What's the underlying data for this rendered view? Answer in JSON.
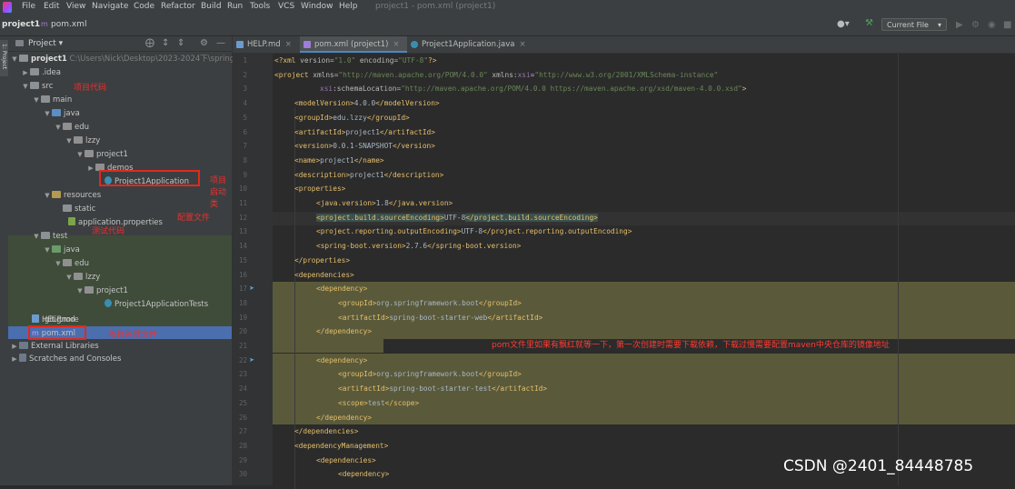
{
  "menu": [
    "File",
    "Edit",
    "View",
    "Navigate",
    "Code",
    "Refactor",
    "Build",
    "Run",
    "Tools",
    "VCS",
    "Window",
    "Help"
  ],
  "window_title": "project1 - pom.xml (project1)",
  "breadcrumb": {
    "project": "project1",
    "file": "pom.xml"
  },
  "run_config": "Current File",
  "project_panel": {
    "title": "Project",
    "root_name": "project1",
    "root_path": "C:\\Users\\Nick\\Desktop\\2023-2024下\\spring",
    "tree": {
      "idea": ".idea",
      "src": "src",
      "main": "main",
      "java": "java",
      "edu": "edu",
      "lzzy": "lzzy",
      "project1": "project1",
      "demos": "demos",
      "app_class": "Project1Application",
      "resources": "resources",
      "static": "static",
      "app_props": "application.properties",
      "test": "test",
      "test_java": "java",
      "test_edu": "edu",
      "test_lzzy": "lzzy",
      "test_project1": "project1",
      "test_class": "Project1ApplicationTests",
      "gitignore": ".gitignore",
      "help": "HELP.md",
      "pom": "pom.xml",
      "ext_libs": "External Libraries",
      "scratches": "Scratches and Consoles"
    },
    "annotations": {
      "project_code": "项目代码",
      "startup_class": "项目启动类",
      "config_file": "配置文件",
      "test_code": "测试代码",
      "deps_file": "依赖管理文件"
    }
  },
  "tabs": [
    {
      "label": "HELP.md"
    },
    {
      "label": "pom.xml (project1)"
    },
    {
      "label": "Project1Application.java"
    }
  ],
  "editor": {
    "line_numbers": [
      "1",
      "2",
      "3",
      "4",
      "5",
      "6",
      "7",
      "8",
      "9",
      "10",
      "11",
      "12",
      "13",
      "14",
      "15",
      "16",
      "17",
      "18",
      "19",
      "20",
      "21",
      "22",
      "23",
      "24",
      "25",
      "26",
      "27",
      "28",
      "29",
      "30"
    ],
    "pom_note": "pom文件里如果有飘红就等一下，第一次创建时需要下载依赖，下载过慢需要配置maven中央仓库的镜像地址"
  },
  "watermark": "CSDN @2401_84448785"
}
